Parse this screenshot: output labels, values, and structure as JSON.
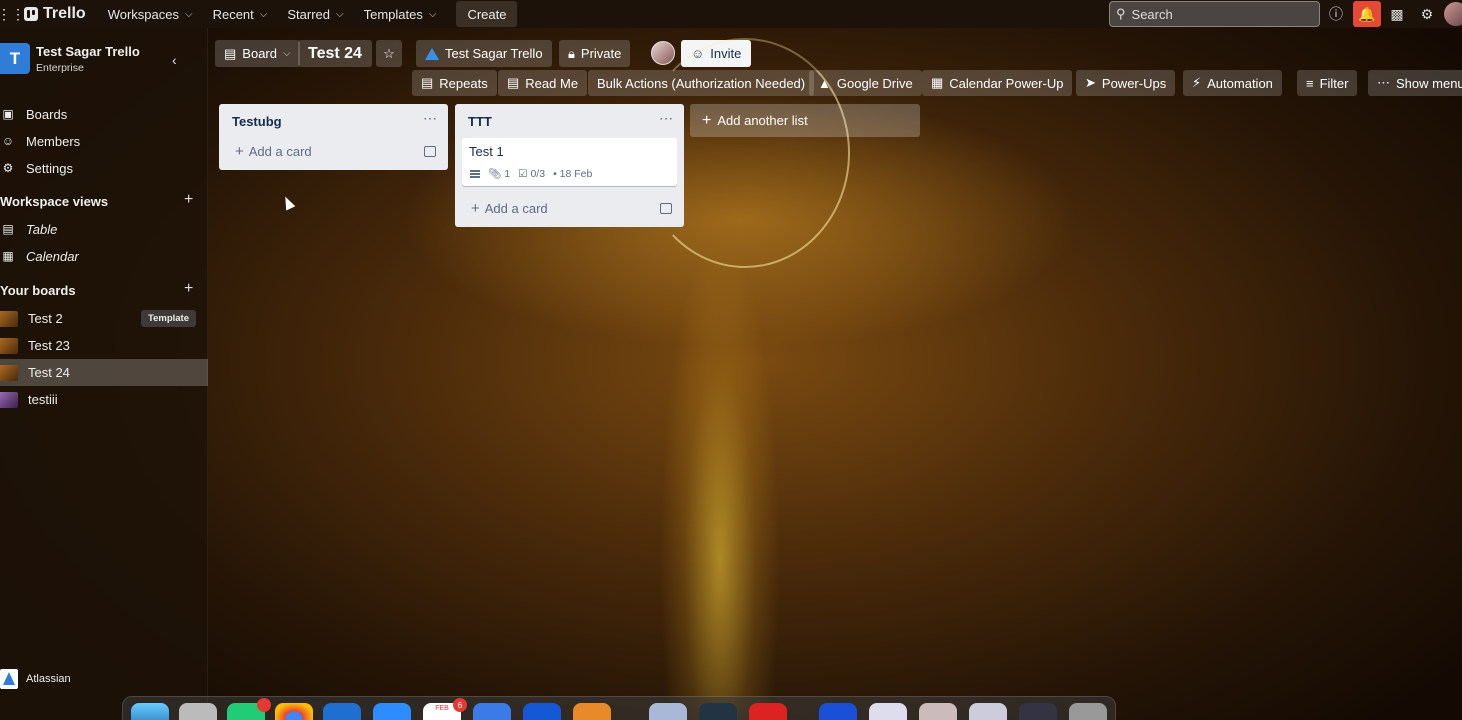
{
  "topbar": {
    "logo": "Trello",
    "nav": [
      {
        "label": "Workspaces"
      },
      {
        "label": "Recent"
      },
      {
        "label": "Starred"
      },
      {
        "label": "Templates"
      }
    ],
    "create_label": "Create",
    "search_placeholder": "Search",
    "accent_notification": "#e34935"
  },
  "sidebar": {
    "workspace_initial": "T",
    "workspace_name": "Test Sagar Trello",
    "workspace_plan": "Enterprise",
    "menu": [
      {
        "label": "Boards",
        "icon": "trello-icon"
      },
      {
        "label": "Members",
        "icon": "person-icon"
      },
      {
        "label": "Settings",
        "icon": "gear-icon"
      }
    ],
    "views_heading": "Workspace views",
    "views": [
      {
        "label": "Table",
        "icon": "table-icon"
      },
      {
        "label": "Calendar",
        "icon": "calendar-icon"
      }
    ],
    "boards_heading": "Your boards",
    "boards": [
      {
        "label": "Test 2",
        "badge": "Template"
      },
      {
        "label": "Test 23"
      },
      {
        "label": "Test 24",
        "active": true
      },
      {
        "label": "testiii"
      }
    ],
    "footer": "Atlassian"
  },
  "board_header": {
    "view_label": "Board",
    "title": "Test 24",
    "workspace_label": "Test Sagar Trello",
    "visibility_label": "Private",
    "invite_label": "Invite",
    "powerups": [
      {
        "label": "Repeats"
      },
      {
        "label": "Read Me"
      },
      {
        "label": "Bulk Actions (Authorization Needed)"
      },
      {
        "label": "Google Drive"
      },
      {
        "label": "Calendar Power-Up"
      },
      {
        "label": "Power-Ups"
      },
      {
        "label": "Automation"
      },
      {
        "label": "Filter"
      },
      {
        "label": "Show menu"
      }
    ]
  },
  "lists": [
    {
      "title": "Testubg",
      "add_card": "Add a card",
      "cards": []
    },
    {
      "title": "TTT",
      "add_card": "Add a card",
      "cards": [
        {
          "title": "Test 1",
          "attachments": "1",
          "checklist": "0/3",
          "due": "18 Feb"
        }
      ]
    }
  ],
  "add_list_label": "Add another list",
  "dock": {
    "calendar_badge": "6",
    "calendar_month": "FEB"
  }
}
